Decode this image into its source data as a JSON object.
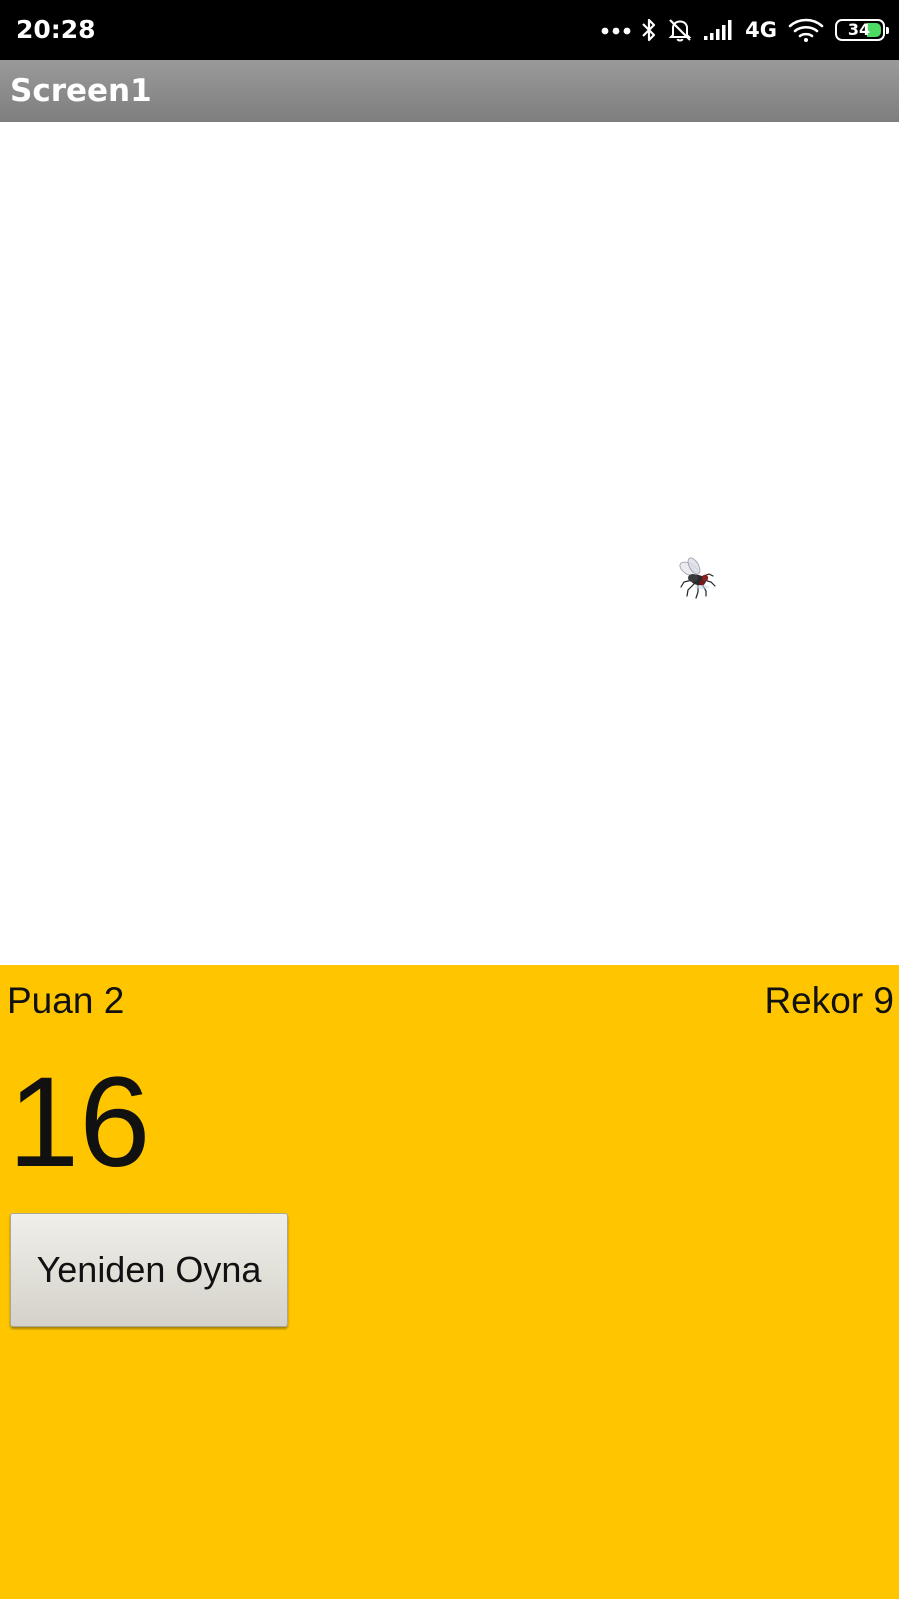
{
  "status_bar": {
    "time": "20:28",
    "network": "4G",
    "battery": "34",
    "icons": [
      "more-dots-icon",
      "bluetooth-icon",
      "bell-off-icon",
      "signal-icon",
      "wifi-icon",
      "battery-icon"
    ],
    "battery_color": "#4cd964"
  },
  "title_bar": {
    "title": "Screen1"
  },
  "game": {
    "sprite": "fly-icon",
    "score_label": "Puan 2",
    "record_label": "Rekor 9",
    "timer": "16",
    "replay_button": "Yeniden Oyna"
  },
  "colors": {
    "panel": "#ffc600",
    "title_bar": "#8a8a8a",
    "canvas": "#ffffff"
  }
}
